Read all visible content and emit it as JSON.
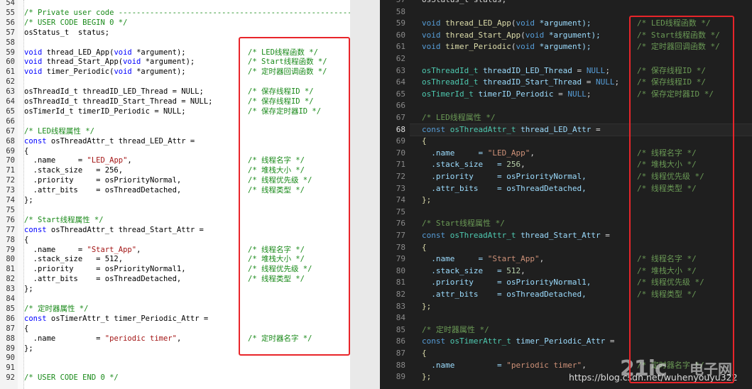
{
  "colors": {
    "left_bg": "#ffffff",
    "right_bg": "#1f1f1f",
    "left_comment": "#1a8a1a",
    "left_keyword": "#0000ff",
    "left_text": "#000000",
    "left_string": "#a31515",
    "left_comment_hdr": "#1a8a1a",
    "right_comment": "#6a9955",
    "right_keyword": "#569cd6",
    "right_type": "#4ec9b0",
    "right_function": "#dcdcaa",
    "right_string": "#ce9178",
    "right_number": "#b5cea8",
    "right_text": "#d4d4d4",
    "right_var": "#9cdcfe",
    "highlight_box": "#e8252a"
  },
  "left_editor": {
    "lines": [
      {
        "n": "54",
        "code": [
          {
            "t": "",
            "c": "text"
          }
        ],
        "comment": ""
      },
      {
        "n": "55",
        "code": [
          {
            "t": "/* Private user code ---------------------------------------------------------",
            "c": "comment"
          }
        ],
        "comment": ""
      },
      {
        "n": "56",
        "code": [
          {
            "t": "/* USER CODE BEGIN 0 */",
            "c": "comment"
          }
        ],
        "comment": ""
      },
      {
        "n": "57",
        "code": [
          {
            "t": "osStatus_t  status;",
            "c": "text"
          }
        ],
        "comment": ""
      },
      {
        "n": "58",
        "code": [
          {
            "t": "",
            "c": "text"
          }
        ],
        "comment": ""
      },
      {
        "n": "59",
        "code": [
          {
            "t": "void",
            "c": "keyword"
          },
          {
            "t": " thread_LED_App(",
            "c": "text"
          },
          {
            "t": "void",
            "c": "keyword"
          },
          {
            "t": " *argument);",
            "c": "text"
          }
        ],
        "comment": "/* LED线程函数 */"
      },
      {
        "n": "60",
        "code": [
          {
            "t": "void",
            "c": "keyword"
          },
          {
            "t": " thread_Start_App(",
            "c": "text"
          },
          {
            "t": "void",
            "c": "keyword"
          },
          {
            "t": " *argument);",
            "c": "text"
          }
        ],
        "comment": "/* Start线程函数 */"
      },
      {
        "n": "61",
        "code": [
          {
            "t": "void",
            "c": "keyword"
          },
          {
            "t": " timer_Periodic(",
            "c": "text"
          },
          {
            "t": "void",
            "c": "keyword"
          },
          {
            "t": " *argument);",
            "c": "text"
          }
        ],
        "comment": "/* 定时器回调函数 */"
      },
      {
        "n": "62",
        "code": [
          {
            "t": "",
            "c": "text"
          }
        ],
        "comment": ""
      },
      {
        "n": "63",
        "code": [
          {
            "t": "osThreadId_t threadID_LED_Thread = NULL;",
            "c": "text"
          }
        ],
        "comment": "/* 保存线程ID */"
      },
      {
        "n": "64",
        "code": [
          {
            "t": "osThreadId_t threadID_Start_Thread = NULL;",
            "c": "text"
          }
        ],
        "comment": "/* 保存线程ID */"
      },
      {
        "n": "65",
        "code": [
          {
            "t": "osTimerId_t timerID_Periodic = NULL;",
            "c": "text"
          }
        ],
        "comment": "/* 保存定时器ID */"
      },
      {
        "n": "66",
        "code": [
          {
            "t": "",
            "c": "text"
          }
        ],
        "comment": ""
      },
      {
        "n": "67",
        "code": [
          {
            "t": "/* LED线程属性 */",
            "c": "comment"
          }
        ],
        "comment": ""
      },
      {
        "n": "68",
        "code": [
          {
            "t": "const",
            "c": "keyword"
          },
          {
            "t": " osThreadAttr_t thread_LED_Attr =",
            "c": "text"
          }
        ],
        "comment": ""
      },
      {
        "n": "69",
        "code": [
          {
            "t": "{",
            "c": "text"
          }
        ],
        "comment": ""
      },
      {
        "n": "70",
        "code": [
          {
            "t": "  .name     = ",
            "c": "text"
          },
          {
            "t": "\"LED_App\"",
            "c": "string"
          },
          {
            "t": ",",
            "c": "text"
          }
        ],
        "comment": "/* 线程名字 */"
      },
      {
        "n": "71",
        "code": [
          {
            "t": "  .stack_size   = 256,",
            "c": "text"
          }
        ],
        "comment": "/* 堆栈大小 */"
      },
      {
        "n": "72",
        "code": [
          {
            "t": "  .priority     = osPriorityNormal,",
            "c": "text"
          }
        ],
        "comment": "/* 线程优先级 */"
      },
      {
        "n": "73",
        "code": [
          {
            "t": "  .attr_bits    = osThreadDetached,",
            "c": "text"
          }
        ],
        "comment": "/* 线程类型 */"
      },
      {
        "n": "74",
        "code": [
          {
            "t": "};",
            "c": "text"
          }
        ],
        "comment": ""
      },
      {
        "n": "75",
        "code": [
          {
            "t": "",
            "c": "text"
          }
        ],
        "comment": ""
      },
      {
        "n": "76",
        "code": [
          {
            "t": "/* Start线程属性 */",
            "c": "comment"
          }
        ],
        "comment": ""
      },
      {
        "n": "77",
        "code": [
          {
            "t": "const",
            "c": "keyword"
          },
          {
            "t": " osThreadAttr_t thread_Start_Attr =",
            "c": "text"
          }
        ],
        "comment": ""
      },
      {
        "n": "78",
        "code": [
          {
            "t": "{",
            "c": "text"
          }
        ],
        "comment": ""
      },
      {
        "n": "79",
        "code": [
          {
            "t": "  .name     = ",
            "c": "text"
          },
          {
            "t": "\"Start_App\"",
            "c": "string"
          },
          {
            "t": ",",
            "c": "text"
          }
        ],
        "comment": "/* 线程名字 */"
      },
      {
        "n": "80",
        "code": [
          {
            "t": "  .stack_size   = 512,",
            "c": "text"
          }
        ],
        "comment": "/* 堆栈大小 */"
      },
      {
        "n": "81",
        "code": [
          {
            "t": "  .priority     = osPriorityNormal1,",
            "c": "text"
          }
        ],
        "comment": "/* 线程优先级 */"
      },
      {
        "n": "82",
        "code": [
          {
            "t": "  .attr_bits    = osThreadDetached,",
            "c": "text"
          }
        ],
        "comment": "/* 线程类型 */"
      },
      {
        "n": "83",
        "code": [
          {
            "t": "};",
            "c": "text"
          }
        ],
        "comment": ""
      },
      {
        "n": "84",
        "code": [
          {
            "t": "",
            "c": "text"
          }
        ],
        "comment": ""
      },
      {
        "n": "85",
        "code": [
          {
            "t": "/* 定时器属性 */",
            "c": "comment"
          }
        ],
        "comment": ""
      },
      {
        "n": "86",
        "code": [
          {
            "t": "const",
            "c": "keyword"
          },
          {
            "t": " osTimerAttr_t timer_Periodic_Attr =",
            "c": "text"
          }
        ],
        "comment": ""
      },
      {
        "n": "87",
        "code": [
          {
            "t": "{",
            "c": "text"
          }
        ],
        "comment": ""
      },
      {
        "n": "88",
        "code": [
          {
            "t": "  .name         = ",
            "c": "text"
          },
          {
            "t": "\"periodic timer\"",
            "c": "string"
          },
          {
            "t": ",",
            "c": "text"
          }
        ],
        "comment": "/* 定时器名字 */"
      },
      {
        "n": "89",
        "code": [
          {
            "t": "};",
            "c": "text"
          }
        ],
        "comment": ""
      },
      {
        "n": "90",
        "code": [
          {
            "t": "",
            "c": "text"
          }
        ],
        "comment": ""
      },
      {
        "n": "91",
        "code": [
          {
            "t": "",
            "c": "text"
          }
        ],
        "comment": ""
      },
      {
        "n": "92",
        "code": [
          {
            "t": "/* USER CODE END 0 */",
            "c": "comment"
          }
        ],
        "comment": ""
      }
    ]
  },
  "right_editor": {
    "active_line": "68",
    "lines": [
      {
        "n": "57",
        "code": [
          {
            "t": "osStatus_t status;",
            "c": "text"
          }
        ],
        "comment": ""
      },
      {
        "n": "58",
        "code": [
          {
            "t": "",
            "c": "text"
          }
        ],
        "comment": ""
      },
      {
        "n": "59",
        "code": [
          {
            "t": "void ",
            "c": "keyword"
          },
          {
            "t": "thread_LED_App",
            "c": "function"
          },
          {
            "t": "(",
            "c": "text"
          },
          {
            "t": "void",
            "c": "keyword"
          },
          {
            "t": " *argument);",
            "c": "var"
          }
        ],
        "comment": "/* LED线程函数 */"
      },
      {
        "n": "60",
        "code": [
          {
            "t": "void ",
            "c": "keyword"
          },
          {
            "t": "thread_Start_App",
            "c": "function"
          },
          {
            "t": "(",
            "c": "text"
          },
          {
            "t": "void",
            "c": "keyword"
          },
          {
            "t": " *argument);",
            "c": "var"
          }
        ],
        "comment": "/* Start线程函数 */"
      },
      {
        "n": "61",
        "code": [
          {
            "t": "void ",
            "c": "keyword"
          },
          {
            "t": "timer_Periodic",
            "c": "function"
          },
          {
            "t": "(",
            "c": "text"
          },
          {
            "t": "void",
            "c": "keyword"
          },
          {
            "t": " *argument);",
            "c": "var"
          }
        ],
        "comment": "/* 定时器回调函数 */"
      },
      {
        "n": "62",
        "code": [
          {
            "t": "",
            "c": "text"
          }
        ],
        "comment": ""
      },
      {
        "n": "63",
        "code": [
          {
            "t": "osThreadId_t ",
            "c": "type"
          },
          {
            "t": "threadID_LED_Thread",
            "c": "var"
          },
          {
            "t": " = ",
            "c": "text"
          },
          {
            "t": "NULL",
            "c": "keyword"
          },
          {
            "t": ";",
            "c": "text"
          }
        ],
        "comment": "/* 保存线程ID */"
      },
      {
        "n": "64",
        "code": [
          {
            "t": "osThreadId_t ",
            "c": "type"
          },
          {
            "t": "threadID_Start_Thread",
            "c": "var"
          },
          {
            "t": " = ",
            "c": "text"
          },
          {
            "t": "NULL",
            "c": "keyword"
          },
          {
            "t": ";",
            "c": "text"
          }
        ],
        "comment": "/* 保存线程ID */"
      },
      {
        "n": "65",
        "code": [
          {
            "t": "osTimerId_t ",
            "c": "type"
          },
          {
            "t": "timerID_Periodic",
            "c": "var"
          },
          {
            "t": " = ",
            "c": "text"
          },
          {
            "t": "NULL",
            "c": "keyword"
          },
          {
            "t": ";",
            "c": "text"
          }
        ],
        "comment": "/* 保存定时器ID */"
      },
      {
        "n": "66",
        "code": [
          {
            "t": "",
            "c": "text"
          }
        ],
        "comment": ""
      },
      {
        "n": "67",
        "code": [
          {
            "t": "/* LED线程属性 */",
            "c": "comment"
          }
        ],
        "comment": ""
      },
      {
        "n": "68",
        "code": [
          {
            "t": "const ",
            "c": "keyword"
          },
          {
            "t": "osThreadAttr_t ",
            "c": "type"
          },
          {
            "t": "thread_LED_Attr",
            "c": "var"
          },
          {
            "t": " =",
            "c": "text"
          }
        ],
        "comment": ""
      },
      {
        "n": "69",
        "code": [
          {
            "t": "{",
            "c": "function"
          }
        ],
        "comment": ""
      },
      {
        "n": "70",
        "code": [
          {
            "t": "  .name     = ",
            "c": "var"
          },
          {
            "t": "\"LED_App\"",
            "c": "string"
          },
          {
            "t": ",",
            "c": "text"
          }
        ],
        "comment": "/* 线程名字 */"
      },
      {
        "n": "71",
        "code": [
          {
            "t": "  .stack_size   = ",
            "c": "var"
          },
          {
            "t": "256",
            "c": "number"
          },
          {
            "t": ",",
            "c": "text"
          }
        ],
        "comment": "/* 堆栈大小 */"
      },
      {
        "n": "72",
        "code": [
          {
            "t": "  .priority     = osPriorityNormal,",
            "c": "var"
          }
        ],
        "comment": "/* 线程优先级 */"
      },
      {
        "n": "73",
        "code": [
          {
            "t": "  .attr_bits    = osThreadDetached,",
            "c": "var"
          }
        ],
        "comment": "/* 线程类型 */"
      },
      {
        "n": "74",
        "code": [
          {
            "t": "};",
            "c": "function"
          }
        ],
        "comment": ""
      },
      {
        "n": "75",
        "code": [
          {
            "t": "",
            "c": "text"
          }
        ],
        "comment": ""
      },
      {
        "n": "76",
        "code": [
          {
            "t": "/* Start线程属性 */",
            "c": "comment"
          }
        ],
        "comment": ""
      },
      {
        "n": "77",
        "code": [
          {
            "t": "const ",
            "c": "keyword"
          },
          {
            "t": "osThreadAttr_t ",
            "c": "type"
          },
          {
            "t": "thread_Start_Attr",
            "c": "var"
          },
          {
            "t": " =",
            "c": "text"
          }
        ],
        "comment": ""
      },
      {
        "n": "78",
        "code": [
          {
            "t": "{",
            "c": "function"
          }
        ],
        "comment": ""
      },
      {
        "n": "79",
        "code": [
          {
            "t": "  .name     = ",
            "c": "var"
          },
          {
            "t": "\"Start_App\"",
            "c": "string"
          },
          {
            "t": ",",
            "c": "text"
          }
        ],
        "comment": "/* 线程名字 */"
      },
      {
        "n": "80",
        "code": [
          {
            "t": "  .stack_size   = ",
            "c": "var"
          },
          {
            "t": "512",
            "c": "number"
          },
          {
            "t": ",",
            "c": "text"
          }
        ],
        "comment": "/* 堆栈大小 */"
      },
      {
        "n": "81",
        "code": [
          {
            "t": "  .priority     = osPriorityNormal1,",
            "c": "var"
          }
        ],
        "comment": "/* 线程优先级 */"
      },
      {
        "n": "82",
        "code": [
          {
            "t": "  .attr_bits    = osThreadDetached,",
            "c": "var"
          }
        ],
        "comment": "/* 线程类型 */"
      },
      {
        "n": "83",
        "code": [
          {
            "t": "};",
            "c": "function"
          }
        ],
        "comment": ""
      },
      {
        "n": "84",
        "code": [
          {
            "t": "",
            "c": "text"
          }
        ],
        "comment": ""
      },
      {
        "n": "85",
        "code": [
          {
            "t": "/* 定时器属性 */",
            "c": "comment"
          }
        ],
        "comment": ""
      },
      {
        "n": "86",
        "code": [
          {
            "t": "const ",
            "c": "keyword"
          },
          {
            "t": "osTimerAttr_t ",
            "c": "type"
          },
          {
            "t": "timer_Periodic_Attr",
            "c": "var"
          },
          {
            "t": " =",
            "c": "text"
          }
        ],
        "comment": ""
      },
      {
        "n": "87",
        "code": [
          {
            "t": "{",
            "c": "function"
          }
        ],
        "comment": ""
      },
      {
        "n": "88",
        "code": [
          {
            "t": "  .name         = ",
            "c": "var"
          },
          {
            "t": "\"periodic timer\"",
            "c": "string"
          },
          {
            "t": ",",
            "c": "text"
          }
        ],
        "comment": "/* 定时器名字 */"
      },
      {
        "n": "89",
        "code": [
          {
            "t": "};",
            "c": "function"
          }
        ],
        "comment": ""
      }
    ]
  },
  "watermark": {
    "logo": "21ic",
    "logo_cn": "电子网",
    "url": "https://blog.csdn.net/wuhenyouyu322"
  }
}
